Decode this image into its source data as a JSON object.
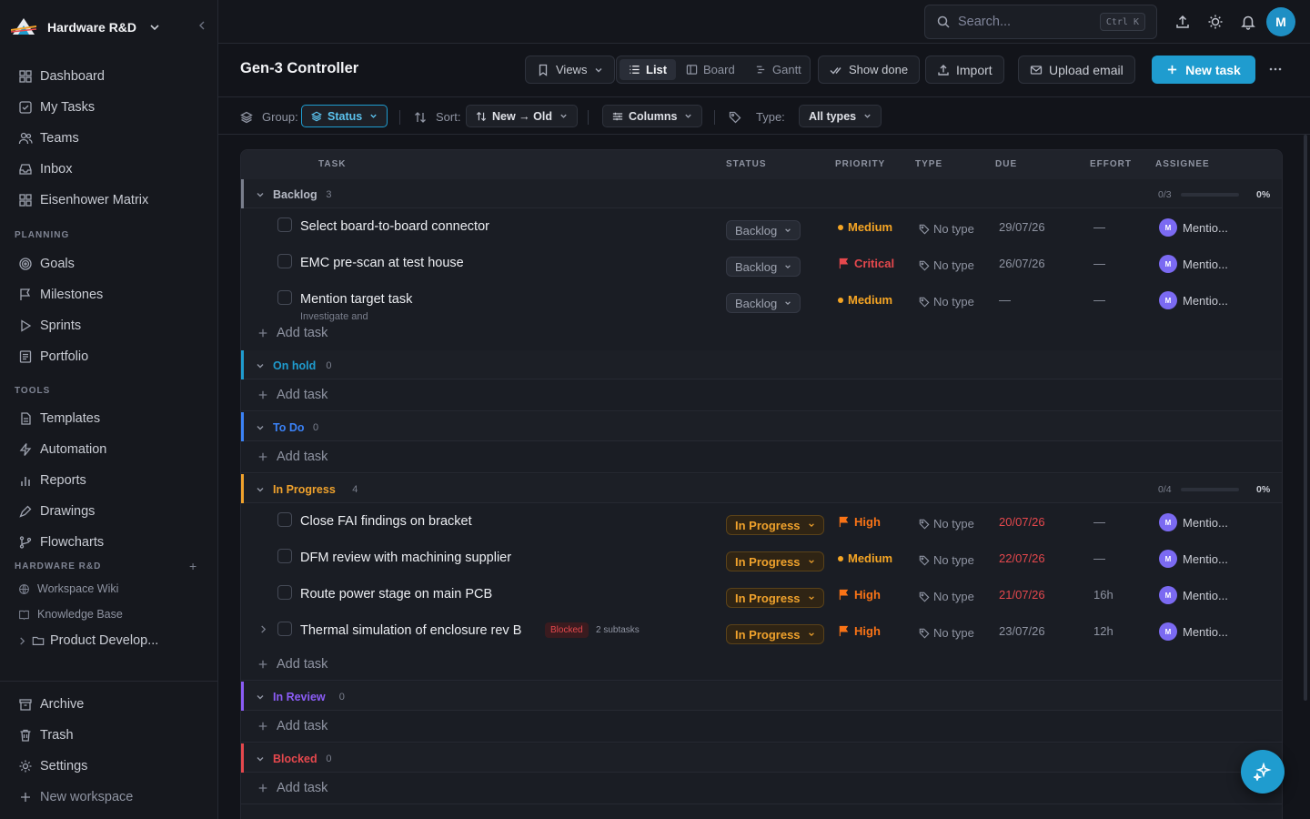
{
  "workspace": {
    "name": "Hardware R&D"
  },
  "nav": {
    "main": [
      "Dashboard",
      "My Tasks",
      "Teams",
      "Inbox",
      "Eisenhower Matrix"
    ],
    "planning_label": "PLANNING",
    "planning": [
      "Goals",
      "Milestones",
      "Sprints",
      "Portfolio"
    ],
    "tools_label": "TOOLS",
    "tools": [
      "Templates",
      "Automation",
      "Reports",
      "Drawings",
      "Flowcharts"
    ],
    "space_label": "HARDWARE R&D",
    "space_items": [
      "Workspace Wiki",
      "Knowledge Base"
    ],
    "folder": "Product Develop...",
    "bottom": [
      "Archive",
      "Trash",
      "Settings",
      "New workspace"
    ]
  },
  "topbar": {
    "search_placeholder": "Search...",
    "shortcut": "Ctrl K",
    "avatar": "M"
  },
  "page": {
    "title": "Gen-3 Controller",
    "views": "Views",
    "view_modes": [
      "List",
      "Board",
      "Gantt"
    ],
    "active_view": "List",
    "show_done": "Show done",
    "import": "Import",
    "upload_email": "Upload email",
    "new_task": "New task"
  },
  "filters": {
    "group_label": "Group:",
    "group_value": "Status",
    "sort_label": "Sort:",
    "sort_value": "New → Old",
    "columns": "Columns",
    "type_label": "Type:",
    "type_value": "All types"
  },
  "columns": [
    "TASK",
    "STATUS",
    "PRIORITY",
    "TYPE",
    "DUE",
    "EFFORT",
    "ASSIGNEE"
  ],
  "add_task_label": "Add task",
  "groups": [
    {
      "name": "Backlog",
      "count": "3",
      "color": "#7a7f8d",
      "progress_text": "0/3",
      "progress": 0,
      "percent": "0%",
      "tasks": [
        {
          "title": "Select board-to-board connector",
          "status": "Backlog",
          "priority": "Medium",
          "type": "No type",
          "due": "29/07/26",
          "effort": "—",
          "assignee": "Mentio...",
          "assignee_initial": "M"
        },
        {
          "title": "EMC pre-scan at test house",
          "status": "Backlog",
          "priority": "Critical",
          "type": "No type",
          "due": "26/07/26",
          "effort": "—",
          "assignee": "Mentio...",
          "assignee_initial": "M"
        },
        {
          "title": "Mention target task",
          "subtitle": "Investigate and",
          "status": "Backlog",
          "priority": "Medium",
          "type": "No type",
          "due": "—",
          "effort": "—",
          "assignee": "Mentio...",
          "assignee_initial": "M"
        }
      ]
    },
    {
      "name": "On hold",
      "count": "0",
      "color": "#1f9ccf",
      "tasks": []
    },
    {
      "name": "To Do",
      "count": "0",
      "color": "#3b82f6",
      "tasks": []
    },
    {
      "name": "In Progress",
      "count": "4",
      "color": "#f0a22c",
      "progress_text": "0/4",
      "progress": 0,
      "percent": "0%",
      "tasks": [
        {
          "title": "Close FAI findings on bracket",
          "status": "In Progress",
          "priority": "High",
          "type": "No type",
          "due": "20/07/26",
          "due_late": true,
          "effort": "—",
          "assignee": "Mentio...",
          "assignee_initial": "M"
        },
        {
          "title": "DFM review with machining supplier",
          "status": "In Progress",
          "priority": "Medium",
          "type": "No type",
          "due": "22/07/26",
          "due_late": true,
          "effort": "—",
          "assignee": "Mentio...",
          "assignee_initial": "M"
        },
        {
          "title": "Route power stage on main PCB",
          "status": "In Progress",
          "priority": "High",
          "type": "No type",
          "due": "21/07/26",
          "due_late": true,
          "effort": "16h",
          "assignee": "Mentio...",
          "assignee_initial": "M"
        },
        {
          "title": "Thermal simulation of enclosure rev B",
          "tag": "Blocked",
          "subtasks": "2 subtasks",
          "status": "In Progress",
          "priority": "High",
          "type": "No type",
          "due": "23/07/26",
          "effort": "12h",
          "assignee": "Mentio...",
          "assignee_initial": "M"
        }
      ]
    },
    {
      "name": "In Review",
      "count": "0",
      "color": "#8b5cf6",
      "tasks": []
    },
    {
      "name": "Blocked",
      "count": "0",
      "color": "#e5484d",
      "tasks": []
    }
  ],
  "colors": {
    "accent": "#1f9ccf",
    "medium": "#f5a524",
    "high": "#f97316",
    "critical": "#e5484d",
    "late": "#e5484d"
  }
}
